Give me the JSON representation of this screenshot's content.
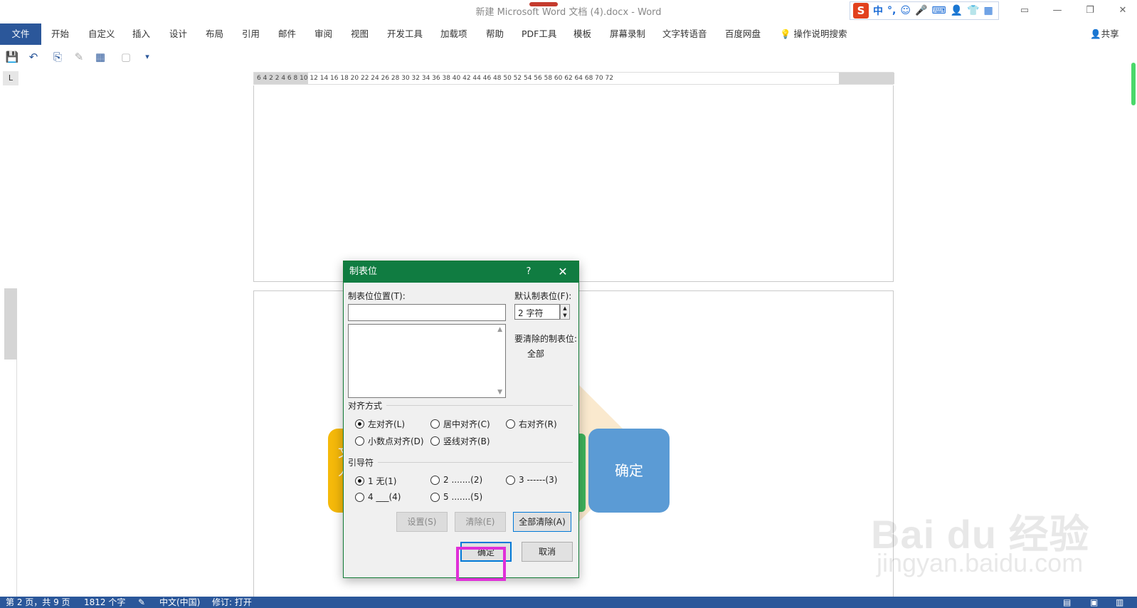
{
  "window": {
    "title": "新建 Microsoft Word 文档 (4).docx  -  Word"
  },
  "ime": {
    "logo": "S",
    "items": [
      "中",
      "°,",
      "☺",
      "🎤",
      "⌨",
      "👤",
      "👕",
      "▦"
    ]
  },
  "ribbon": {
    "tabs": [
      "文件",
      "开始",
      "自定义",
      "插入",
      "设计",
      "布局",
      "引用",
      "邮件",
      "审阅",
      "视图",
      "开发工具",
      "加载项",
      "帮助",
      "PDF工具",
      "模板",
      "屏幕录制",
      "文字转语音",
      "百度网盘"
    ],
    "tell_me": "操作说明搜索",
    "share": "共享"
  },
  "ruler": {
    "corner": "L",
    "numbers": "6    4    2         2    4    6    8    10   12   14   16   18   20   22   24   26   28   30   32   34   36   38   40   42   44   46   48   50   52   54   56   58   60   62   64        68   70   72"
  },
  "document": {
    "yellow_shape_text": "文\n人",
    "blue_shape_text": "确定"
  },
  "dialog": {
    "title": "制表位",
    "help": "?",
    "close": "✕",
    "tab_position_label": "制表位位置(T):",
    "tab_position_value": "",
    "default_tab_label": "默认制表位(F):",
    "default_tab_value": "2 字符",
    "to_clear_label": "要清除的制表位:",
    "to_clear_value": "全部",
    "alignment_label": "对齐方式",
    "alignment_options": [
      {
        "label": "左对齐(L)",
        "selected": true
      },
      {
        "label": "居中对齐(C)",
        "selected": false
      },
      {
        "label": "右对齐(R)",
        "selected": false
      },
      {
        "label": "小数点对齐(D)",
        "selected": false
      },
      {
        "label": "竖线对齐(B)",
        "selected": false
      }
    ],
    "leader_label": "引导符",
    "leader_options": [
      {
        "label": "1 无(1)",
        "selected": true
      },
      {
        "label": "2 .......(2)",
        "selected": false
      },
      {
        "label": "3 ------(3)",
        "selected": false
      },
      {
        "label": "4 ___(4)",
        "selected": false
      },
      {
        "label": "5 .......(5)",
        "selected": false
      }
    ],
    "set_button": "设置(S)",
    "clear_button": "清除(E)",
    "clear_all_button": "全部清除(A)",
    "ok_button": "确定",
    "cancel_button": "取消"
  },
  "statusbar": {
    "page": "第 2 页，共 9 页",
    "words": "1812 个字",
    "language": "中文(中国)",
    "track_changes": "修订: 打开"
  },
  "watermark": {
    "brand": "Bai  du 经验",
    "url": "jingyan.baidu.com"
  },
  "colors": {
    "word_blue": "#2b579a",
    "dialog_green": "#107c41",
    "highlight": "#e02fd8"
  }
}
